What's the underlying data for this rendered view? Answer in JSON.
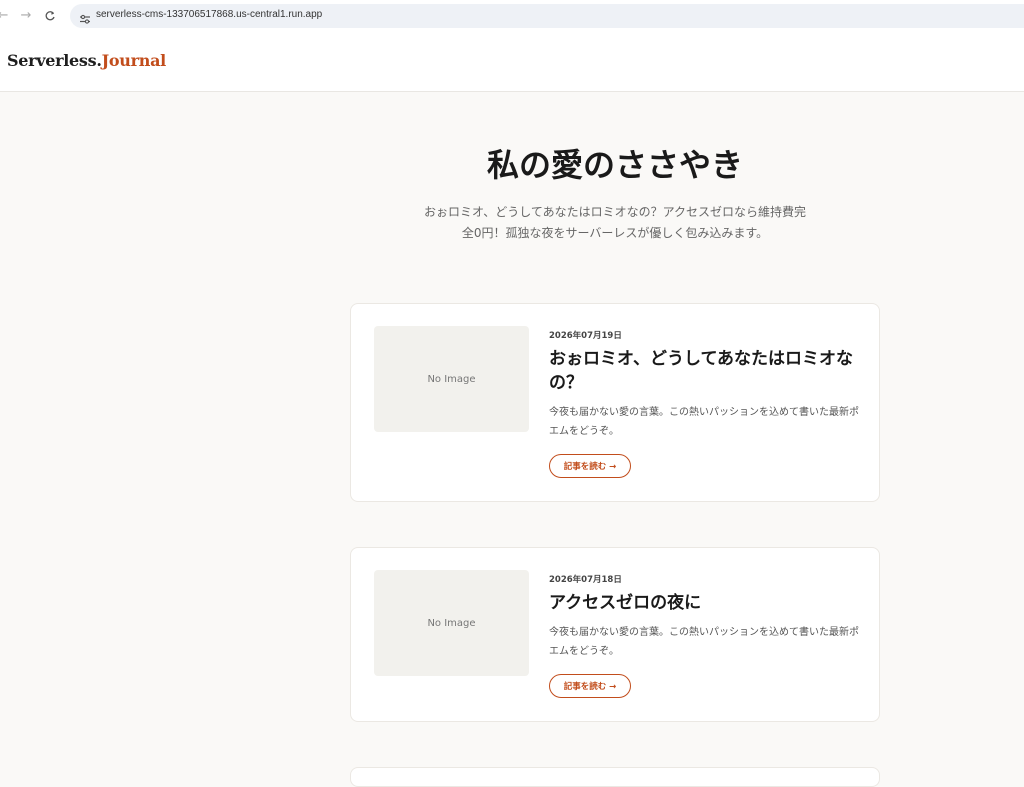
{
  "browser": {
    "url": "serverless-cms-133706517868.us-central1.run.app",
    "back_glyph": "←",
    "forward_glyph": "→",
    "reload_glyph": "C"
  },
  "site": {
    "logo_primary": "Serverless.",
    "logo_accent": "Journal",
    "accent_color": "#c24d1c"
  },
  "hero": {
    "title": "私の愛のささやき",
    "subtitle_line1": "おぉロミオ、どうしてあなたはロミオなの？アクセスゼロなら維持費完",
    "subtitle_line2": "全0円！孤独な夜をサーバーレスが優しく包み込みます。"
  },
  "posts": [
    {
      "date": "2026年07月19日",
      "title": "おぉロミオ、どうしてあなたはロミオなの？",
      "excerpt": "今夜も届かない愛の言葉。この熱いパッションを込めて書いた最新ポエムをどうぞ。",
      "thumb_label": "No Image",
      "read_label": "記事を読む →"
    },
    {
      "date": "2026年07月18日",
      "title": "アクセスゼロの夜に",
      "excerpt": "今夜も届かない愛の言葉。この熱いパッションを込めて書いた最新ポエムをどうぞ。",
      "thumb_label": "No Image",
      "read_label": "記事を読む →"
    }
  ]
}
